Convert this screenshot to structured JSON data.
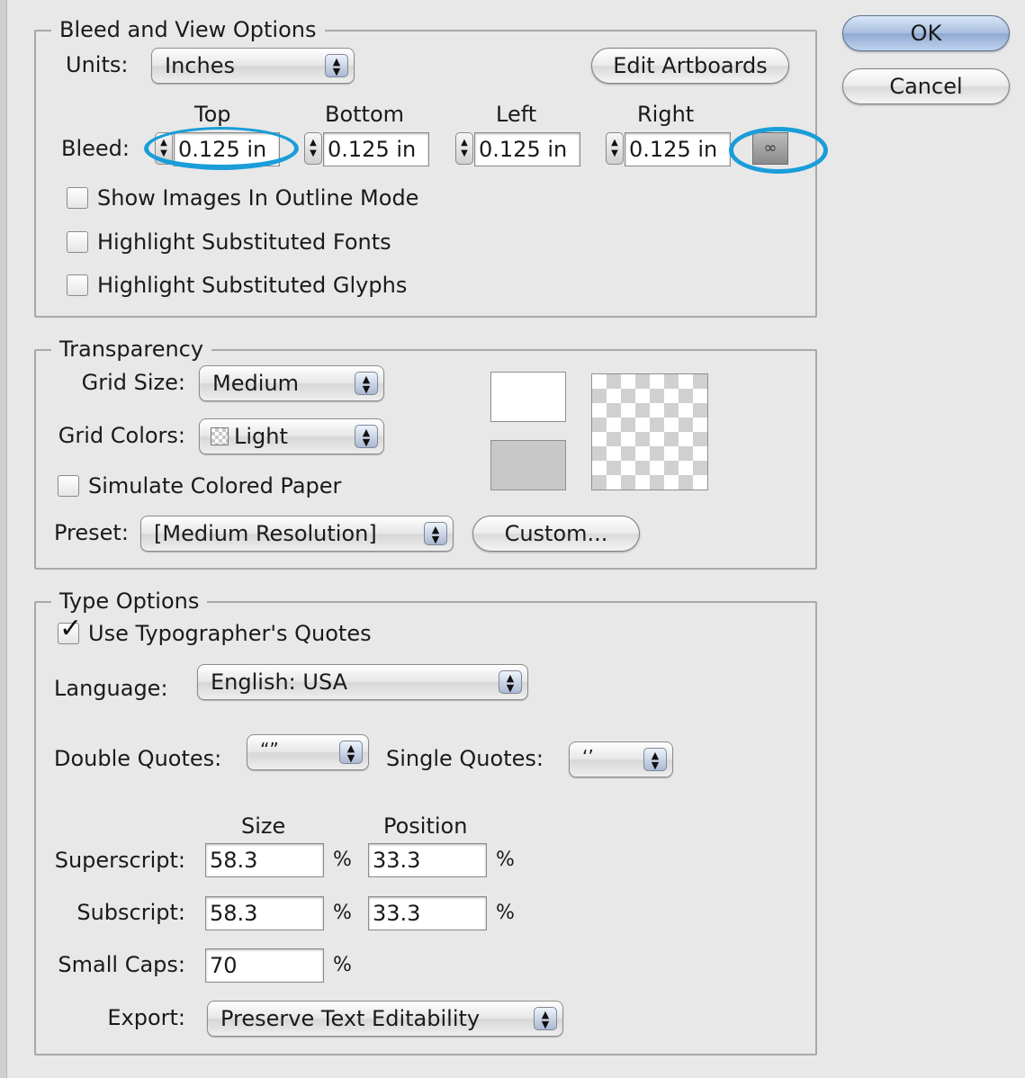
{
  "buttons": {
    "ok": "OK",
    "cancel": "Cancel"
  },
  "bleed_view": {
    "legend": "Bleed and View Options",
    "units_label": "Units:",
    "units_value": "Inches",
    "edit_artboards": "Edit Artboards",
    "bleed_label": "Bleed:",
    "bleed_columns": [
      "Top",
      "Bottom",
      "Left",
      "Right"
    ],
    "bleed_values": [
      "0.125 in",
      "0.125 in",
      "0.125 in",
      "0.125 in"
    ],
    "checkboxes": [
      {
        "label": "Show Images In Outline Mode",
        "checked": false
      },
      {
        "label": "Highlight Substituted Fonts",
        "checked": false
      },
      {
        "label": "Highlight Substituted Glyphs",
        "checked": false
      }
    ]
  },
  "transparency": {
    "legend": "Transparency",
    "grid_size_label": "Grid Size:",
    "grid_size_value": "Medium",
    "grid_colors_label": "Grid Colors:",
    "grid_colors_value": "Light",
    "simulate_label": "Simulate Colored Paper",
    "simulate_checked": false,
    "preset_label": "Preset:",
    "preset_value": "[Medium Resolution]",
    "custom_button": "Custom...",
    "swatch_colors": [
      "#ffffff",
      "#c8c8c8"
    ]
  },
  "type_options": {
    "legend": "Type Options",
    "typographers_quotes_label": "Use Typographer's Quotes",
    "typographers_quotes_checked": true,
    "language_label": "Language:",
    "language_value": "English: USA",
    "double_quotes_label": "Double Quotes:",
    "double_quotes_value": "“”",
    "single_quotes_label": "Single Quotes:",
    "single_quotes_value": "‘’",
    "size_header": "Size",
    "position_header": "Position",
    "superscript_label": "Superscript:",
    "superscript_size": "58.3",
    "superscript_position": "33.3",
    "subscript_label": "Subscript:",
    "subscript_size": "58.3",
    "subscript_position": "33.3",
    "small_caps_label": "Small Caps:",
    "small_caps_value": "70",
    "percent": "%",
    "export_label": "Export:",
    "export_value": "Preserve Text Editability"
  },
  "annotation_color": "#1a9dd9"
}
